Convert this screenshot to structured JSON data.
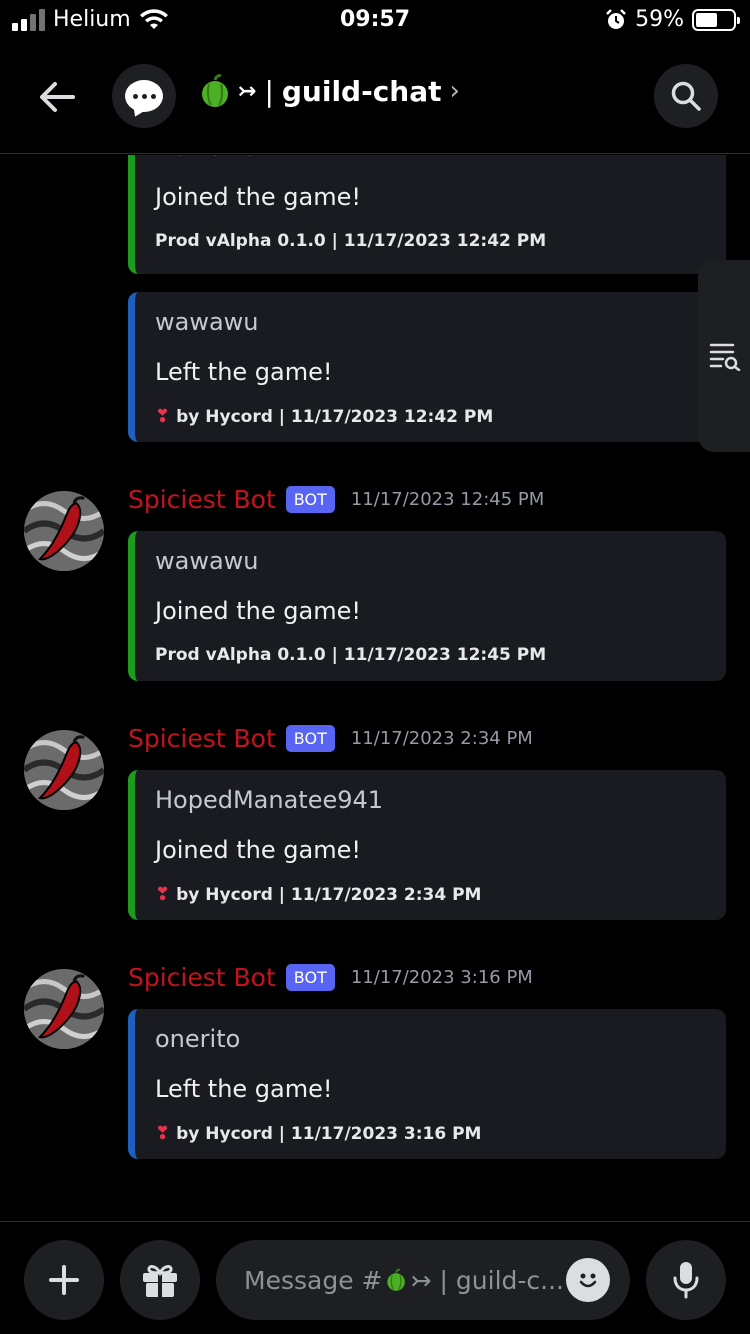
{
  "status_bar": {
    "carrier": "Helium",
    "time": "09:57",
    "battery_percent": "59%",
    "battery_level": 0.59
  },
  "header": {
    "channel_name": "guild-chat",
    "channel_prefix": "↣",
    "separator": "|",
    "chevron": "›"
  },
  "messages": [
    {
      "embed_author": "wawawu",
      "embed_text": "Joined the game!",
      "embed_footer": "Prod vAlpha 0.1.0 | 11/17/2023 12:42 PM",
      "accent": "#1e9b1e"
    },
    {
      "embed_author": "wawawu",
      "embed_text": "Left the game!",
      "embed_footer": "by Hycord | 11/17/2023 12:42 PM",
      "footer_icon": "heart-exclamation-icon",
      "accent": "#1f5fbf"
    },
    {
      "bot_name": "Spiciest Bot",
      "bot_tag": "BOT",
      "timestamp": "11/17/2023 12:45 PM",
      "embed_author": "wawawu",
      "embed_text": "Joined the game!",
      "embed_footer": "Prod vAlpha 0.1.0 | 11/17/2023 12:45 PM",
      "accent": "#1e9b1e"
    },
    {
      "bot_name": "Spiciest Bot",
      "bot_tag": "BOT",
      "timestamp": "11/17/2023 2:34 PM",
      "embed_author": "HopedManatee941",
      "embed_text": "Joined the game!",
      "embed_footer": "by Hycord | 11/17/2023 2:34 PM",
      "footer_icon": "heart-exclamation-icon",
      "accent": "#1e9b1e"
    },
    {
      "bot_name": "Spiciest Bot",
      "bot_tag": "BOT",
      "timestamp": "11/17/2023 3:16 PM",
      "embed_author": "onerito",
      "embed_text": "Left the game!",
      "embed_footer": "by Hycord | 11/17/2023 3:16 PM",
      "footer_icon": "heart-exclamation-icon",
      "accent": "#1f5fbf"
    }
  ],
  "composer": {
    "placeholder_prefix": "Message #",
    "placeholder_channel": "↣ | guild-c..."
  },
  "colors": {
    "bot_name": "#c0141e",
    "bot_tag": "#5865f2",
    "join_accent": "#1e9b1e",
    "leave_accent": "#1f5fbf"
  }
}
